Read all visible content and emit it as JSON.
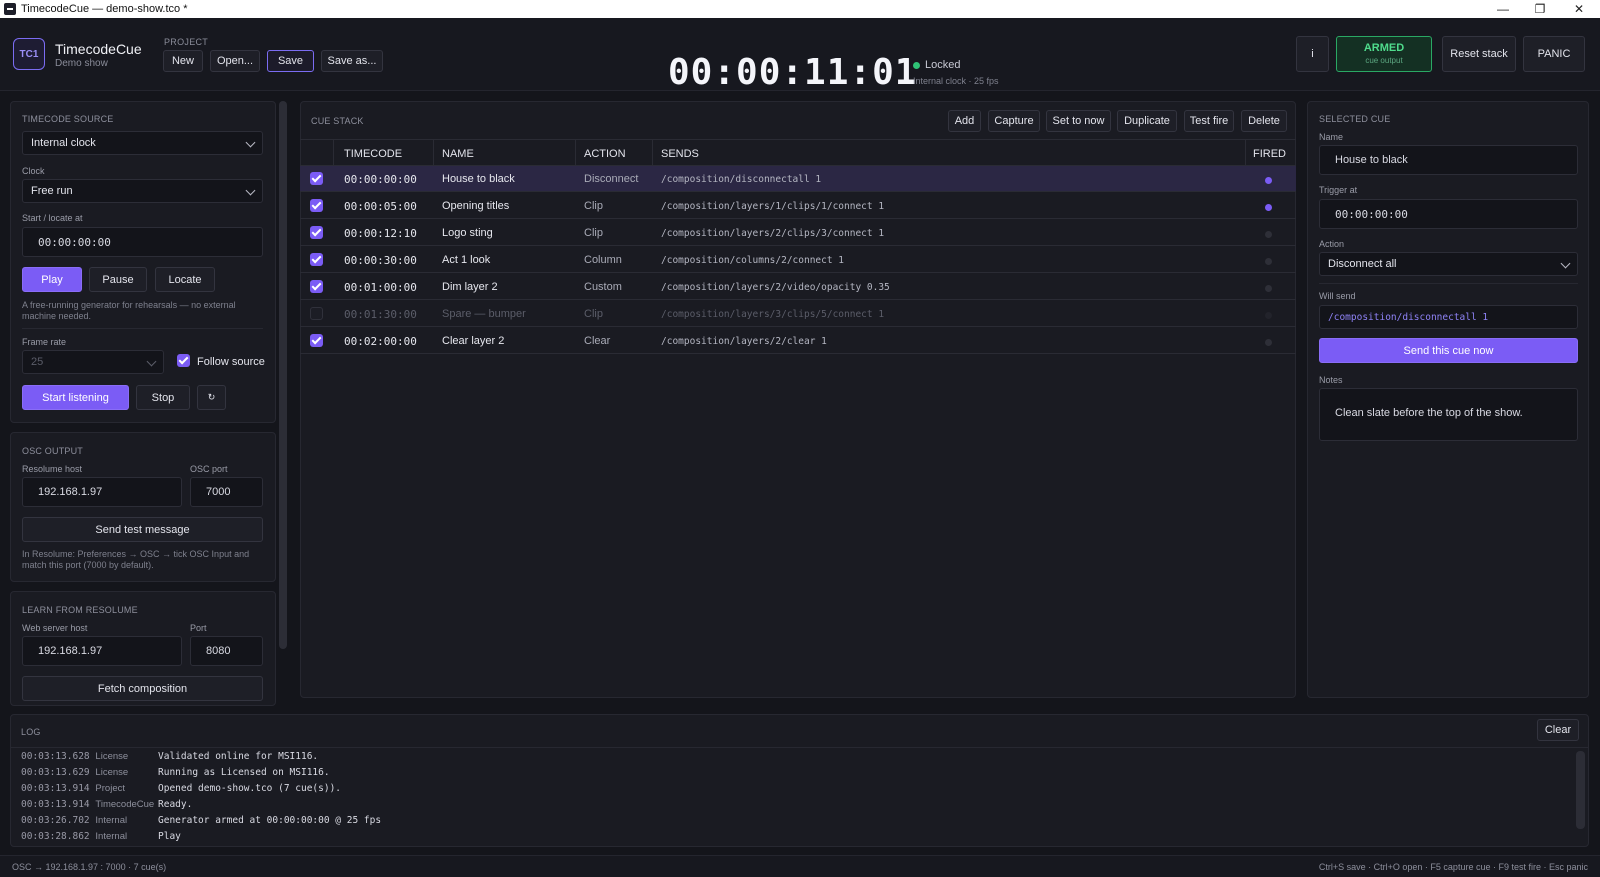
{
  "window": {
    "title": "TimecodeCue — demo-show.tco *"
  },
  "header": {
    "logo": "TC1",
    "app_name": "TimecodeCue",
    "show_name": "Demo show",
    "project_label": "PROJECT",
    "buttons": {
      "new": "New",
      "open": "Open...",
      "save": "Save",
      "save_as": "Save as..."
    },
    "timecode": "00:00:11:01",
    "lock_status": "Locked",
    "lock_sub": "Internal clock · 25 fps",
    "info": "i",
    "armed": "ARMED",
    "armed_sub": "cue output",
    "reset_stack": "Reset stack",
    "panic": "PANIC"
  },
  "timecode_source": {
    "label": "TIMECODE SOURCE",
    "source": "Internal clock",
    "clock_label": "Clock",
    "clock": "Free run",
    "start_label": "Start / locate at",
    "start_value": "00:00:00:00",
    "play": "Play",
    "pause": "Pause",
    "locate": "Locate",
    "help": "A free-running generator for rehearsals — no external machine needed.",
    "frame_rate_label": "Frame rate",
    "frame_rate": "25",
    "follow_source": "Follow source",
    "start_listening": "Start listening",
    "stop": "Stop",
    "small_btn": "↻"
  },
  "osc_output": {
    "label": "OSC OUTPUT",
    "host_label": "Resolume host",
    "host": "192.168.1.97",
    "port_label": "OSC port",
    "port": "7000",
    "send_test": "Send test message",
    "help": "In Resolume: Preferences → OSC → tick OSC Input and match this port (7000 by default)."
  },
  "learn": {
    "label": "LEARN FROM RESOLUME",
    "host_label": "Web server host",
    "host": "192.168.1.97",
    "port_label": "Port",
    "port": "8080",
    "fetch": "Fetch composition"
  },
  "cue_stack": {
    "label": "CUE STACK",
    "buttons": {
      "add": "Add",
      "capture": "Capture",
      "set_to_now": "Set to now",
      "duplicate": "Duplicate",
      "test_fire": "Test fire",
      "delete": "Delete"
    },
    "columns": {
      "timecode": "TIMECODE",
      "name": "NAME",
      "action": "ACTION",
      "sends": "SENDS",
      "fired": "FIRED"
    },
    "rows": [
      {
        "tc": "00:00:00:00",
        "name": "House to black",
        "action": "Disconnect",
        "sends": "/composition/disconnectall 1"
      },
      {
        "tc": "00:00:05:00",
        "name": "Opening titles",
        "action": "Clip",
        "sends": "/composition/layers/1/clips/1/connect 1"
      },
      {
        "tc": "00:00:12:10",
        "name": "Logo sting",
        "action": "Clip",
        "sends": "/composition/layers/2/clips/3/connect 1"
      },
      {
        "tc": "00:00:30:00",
        "name": "Act 1 look",
        "action": "Column",
        "sends": "/composition/columns/2/connect 1"
      },
      {
        "tc": "00:01:00:00",
        "name": "Dim layer 2",
        "action": "Custom",
        "sends": "/composition/layers/2/video/opacity 0.35"
      },
      {
        "tc": "00:01:30:00",
        "name": "Spare — bumper",
        "action": "Clip",
        "sends": "/composition/layers/3/clips/5/connect 1"
      },
      {
        "tc": "00:02:00:00",
        "name": "Clear layer 2",
        "action": "Clear",
        "sends": "/composition/layers/2/clear 1"
      }
    ]
  },
  "selected_cue": {
    "label": "SELECTED CUE",
    "name_label": "Name",
    "name": "House to black",
    "trigger_label": "Trigger at",
    "trigger": "00:00:00:00",
    "action_label": "Action",
    "action": "Disconnect all",
    "will_send_label": "Will send",
    "will_send": "/composition/disconnectall 1",
    "send_now": "Send this cue now",
    "notes_label": "Notes",
    "notes": "Clean slate before the top of the show."
  },
  "log": {
    "label": "LOG",
    "clear": "Clear",
    "entries": [
      {
        "time": "00:03:13.628",
        "source": "License",
        "msg": "Validated online for MSI116."
      },
      {
        "time": "00:03:13.629",
        "source": "License",
        "msg": "Running as Licensed on MSI116."
      },
      {
        "time": "00:03:13.914",
        "source": "Project",
        "msg": "Opened demo-show.tco (7 cue(s))."
      },
      {
        "time": "00:03:13.914",
        "source": "TimecodeCue",
        "msg": "Ready."
      },
      {
        "time": "00:03:26.702",
        "source": "Internal",
        "msg": "Generator armed at 00:00:00:00 @ 25 fps"
      },
      {
        "time": "00:03:28.862",
        "source": "Internal",
        "msg": "Play"
      }
    ]
  },
  "status": {
    "left": "OSC → 192.168.1.97 : 7000 · 7 cue(s)",
    "right": "Ctrl+S save · Ctrl+O open · F5 capture cue · F9 test fire · Esc panic"
  }
}
